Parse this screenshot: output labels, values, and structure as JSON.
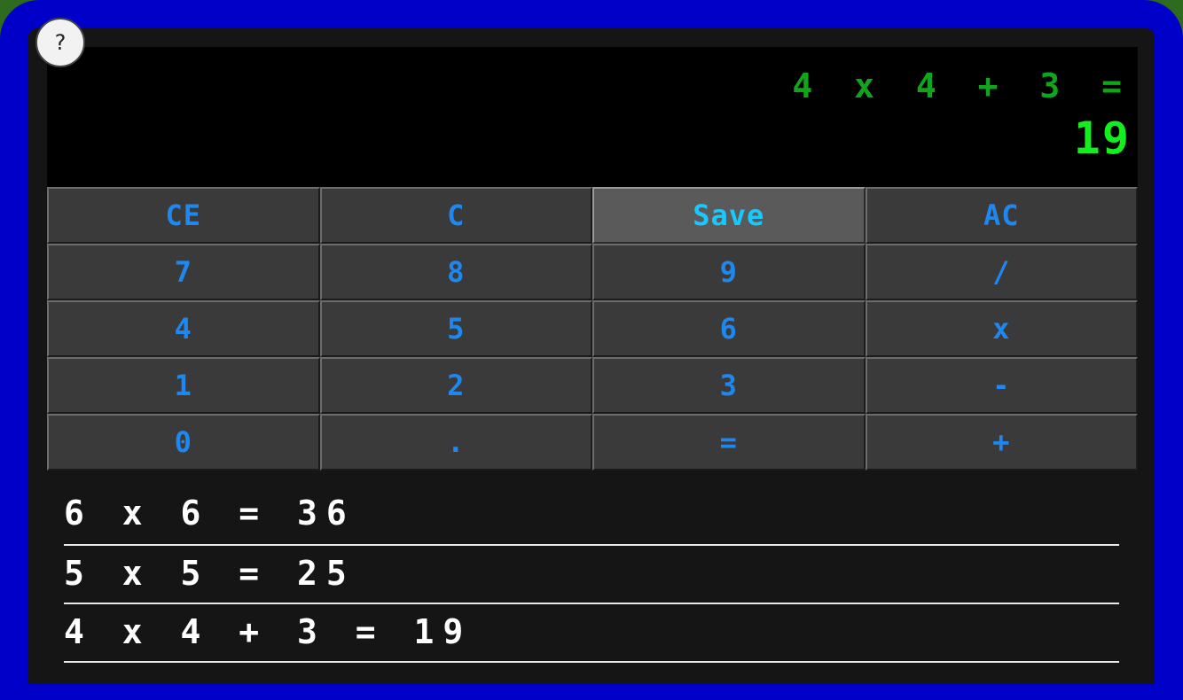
{
  "help": {
    "label": "?"
  },
  "display": {
    "expression": "4 x 4 + 3 =",
    "result": "19"
  },
  "keys": [
    {
      "label": "CE",
      "name": "clear-entry-button"
    },
    {
      "label": "C",
      "name": "clear-button"
    },
    {
      "label": "Save",
      "name": "save-button",
      "active": true
    },
    {
      "label": "AC",
      "name": "all-clear-button"
    },
    {
      "label": "7",
      "name": "digit-7-button"
    },
    {
      "label": "8",
      "name": "digit-8-button"
    },
    {
      "label": "9",
      "name": "digit-9-button"
    },
    {
      "label": "/",
      "name": "divide-button"
    },
    {
      "label": "4",
      "name": "digit-4-button"
    },
    {
      "label": "5",
      "name": "digit-5-button"
    },
    {
      "label": "6",
      "name": "digit-6-button"
    },
    {
      "label": "x",
      "name": "multiply-button"
    },
    {
      "label": "1",
      "name": "digit-1-button"
    },
    {
      "label": "2",
      "name": "digit-2-button"
    },
    {
      "label": "3",
      "name": "digit-3-button"
    },
    {
      "label": "-",
      "name": "subtract-button"
    },
    {
      "label": "0",
      "name": "digit-0-button"
    },
    {
      "label": ".",
      "name": "decimal-button"
    },
    {
      "label": "=",
      "name": "equals-button"
    },
    {
      "label": "+",
      "name": "add-button"
    }
  ],
  "history": [
    "6 x 6 = 36",
    "5 x 5 = 25",
    "4 x 4 + 3 = 19"
  ]
}
